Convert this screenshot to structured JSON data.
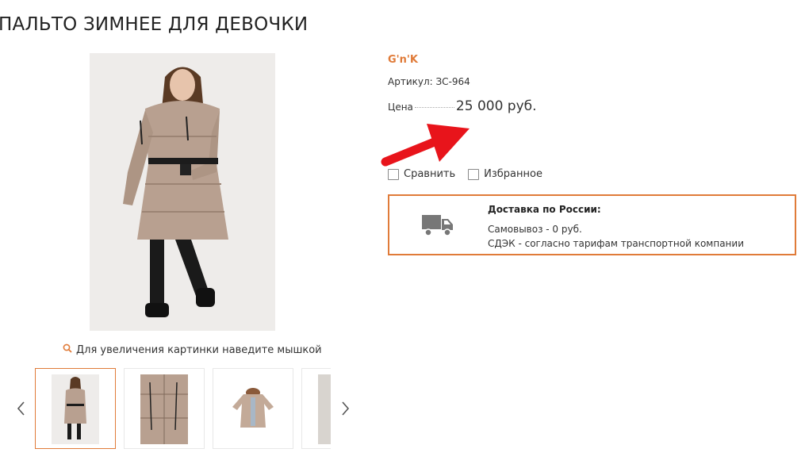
{
  "product": {
    "title": "ПАЛЬТО ЗИМНЕЕ ДЛЯ ДЕВОЧКИ",
    "brand": "G'n'K",
    "sku": "Артикул: ЗС-964",
    "price_label": "Цена",
    "price": "25 000 руб."
  },
  "gallery": {
    "zoom_hint": "Для увеличения картинки наведите мышкой",
    "active_index": 0,
    "thumbnails": [
      "thumbnail-front",
      "thumbnail-detail",
      "thumbnail-flat",
      "thumbnail-partial"
    ]
  },
  "actions": {
    "compare_label": "Сравнить",
    "favorite_label": "Избранное"
  },
  "delivery": {
    "title": "Доставка по России:",
    "line1": "Самовывоз - 0 руб.",
    "line2": "СДЭК - согласно тарифам транспортной компании"
  },
  "colors": {
    "accent": "#e07b39",
    "annotation_arrow": "#e8141b"
  },
  "icons": {
    "zoom": "search-icon",
    "prev": "chevron-left-icon",
    "next": "chevron-right-icon",
    "delivery": "truck-icon"
  }
}
